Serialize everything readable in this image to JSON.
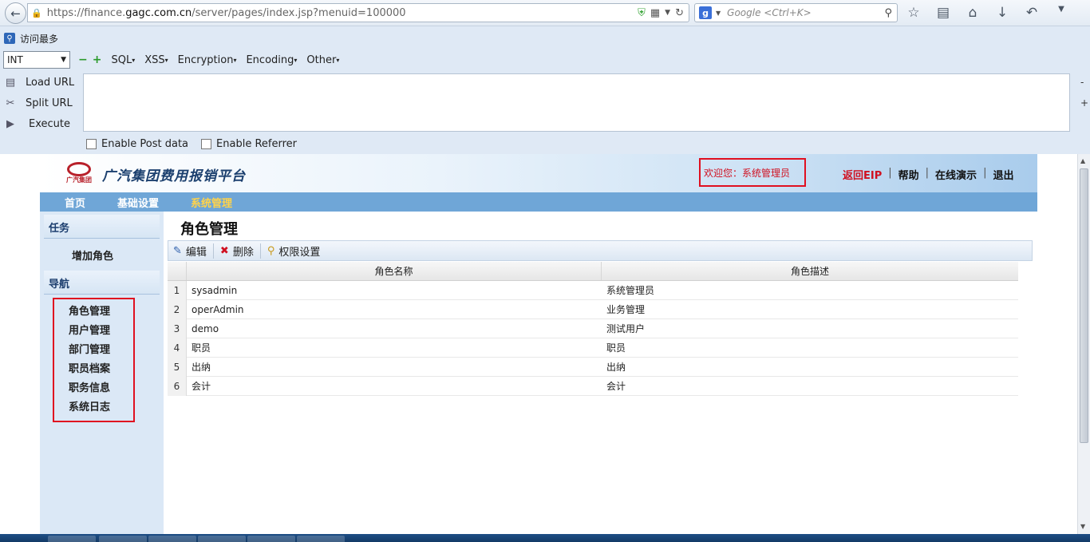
{
  "browser": {
    "url_prefix": "https://finance.",
    "url_domain": "gagc.com.cn",
    "url_path": "/server/pages/index.jsp?menuid=100000",
    "search_placeholder": "Google <Ctrl+K>",
    "bookmark_label": "访问最多"
  },
  "hackbar": {
    "select_value": "INT",
    "menus": [
      "SQL",
      "XSS",
      "Encryption",
      "Encoding",
      "Other"
    ],
    "actions": [
      "Load URL",
      "Split URL",
      "Execute"
    ],
    "checkbox_post": "Enable Post data",
    "checkbox_referrer": "Enable Referrer"
  },
  "site": {
    "title": "广汽集团费用报销平台",
    "logo_text": "广汽集团",
    "welcome": "欢迎您：系统管理员",
    "links": {
      "eip": "返回EIP",
      "help": "帮助",
      "demo": "在线演示",
      "logout": "退出"
    },
    "nav": [
      "首页",
      "基础设置",
      "系统管理"
    ]
  },
  "sidebar": {
    "task_header": "任务",
    "task_item": "增加角色",
    "nav_header": "导航",
    "nav_items": [
      "角色管理",
      "用户管理",
      "部门管理",
      "职员档案",
      "职务信息",
      "系统日志"
    ]
  },
  "content": {
    "title": "角色管理",
    "toolbar": {
      "edit": "编辑",
      "delete": "删除",
      "perm": "权限设置"
    },
    "columns": [
      "角色名称",
      "角色描述"
    ],
    "rows": [
      {
        "num": "1",
        "name": "sysadmin",
        "desc": "系统管理员"
      },
      {
        "num": "2",
        "name": "operAdmin",
        "desc": "业务管理"
      },
      {
        "num": "3",
        "name": "demo",
        "desc": "测试用户"
      },
      {
        "num": "4",
        "name": "职员",
        "desc": "职员"
      },
      {
        "num": "5",
        "name": "出纳",
        "desc": "出纳"
      },
      {
        "num": "6",
        "name": "会计",
        "desc": "会计"
      }
    ]
  }
}
